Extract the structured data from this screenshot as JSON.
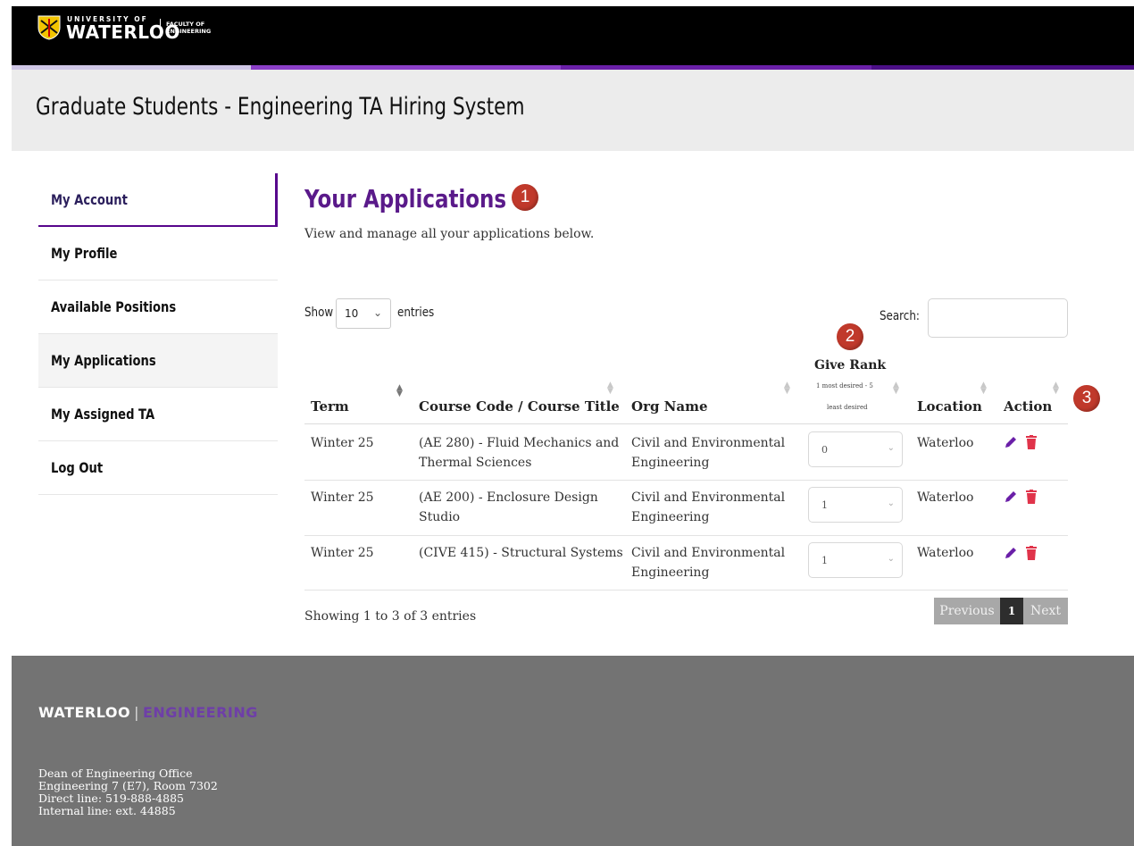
{
  "brand": {
    "university_small": "UNIVERSITY OF",
    "university_name": "WATERLOO",
    "faculty": "FACULTY OF ENGINEERING",
    "stripe_colors": [
      "#cfc6e6",
      "#8b3fc7",
      "#6a1fa8",
      "#4b0f86"
    ]
  },
  "header": {
    "title": "Graduate Students - Engineering TA Hiring System"
  },
  "sidebar": {
    "items": [
      {
        "label": "My Account"
      },
      {
        "label": "My Profile"
      },
      {
        "label": "Available Positions"
      },
      {
        "label": "My Applications"
      },
      {
        "label": "My Assigned TA"
      },
      {
        "label": "Log Out"
      }
    ]
  },
  "main": {
    "title": "Your Applications",
    "subtitle": "View and manage all your applications below.",
    "show_label": "Show",
    "entries_value": "10",
    "entries_label": "entries",
    "search_label": "Search:",
    "search_value": ""
  },
  "badges": [
    "1",
    "2",
    "3"
  ],
  "table": {
    "headers": {
      "term": "Term",
      "course": "Course Code / Course Title",
      "org": "Org Name",
      "rank": "Give Rank",
      "rank_hint_1": "1 most desired - 5",
      "rank_hint_2": "least desired",
      "location": "Location",
      "action": "Action"
    },
    "rows": [
      {
        "term": "Winter 25",
        "course_1": "(AE 280) - Fluid Mechanics and",
        "course_2": "Thermal Sciences",
        "org_1": "Civil and Environmental",
        "org_2": "Engineering",
        "rank": "0",
        "location": "Waterloo"
      },
      {
        "term": "Winter 25",
        "course_1": "(AE 200) - Enclosure Design",
        "course_2": "Studio",
        "org_1": "Civil and Environmental",
        "org_2": "Engineering",
        "rank": "1",
        "location": "Waterloo"
      },
      {
        "term": "Winter 25",
        "course_1": "(CIVE 415) - Structural Systems",
        "course_2": "",
        "org_1": "Civil and Environmental",
        "org_2": "Engineering",
        "rank": "1",
        "location": "Waterloo"
      }
    ],
    "icons": {
      "edit": "pencil-icon",
      "delete": "trash-icon"
    },
    "icon_colors": {
      "edit": "#6a1fa8",
      "delete": "#e0334a"
    }
  },
  "footer_table": {
    "showing": "Showing 1 to 3 of 3 entries",
    "prev": "Previous",
    "page": "1",
    "next": "Next"
  },
  "footer": {
    "logo_left": "WATERLOO",
    "logo_sep": "|",
    "logo_right": "ENGINEERING",
    "address": [
      "Dean of Engineering Office",
      "Engineering 7 (E7), Room 7302",
      "Direct line: 519-888-4885",
      "Internal line: ext. 44885"
    ]
  },
  "colors": {
    "accent": "#57068c",
    "title": "#5a1a8a",
    "badge": "#c0392b",
    "footer_bg": "#737373"
  }
}
